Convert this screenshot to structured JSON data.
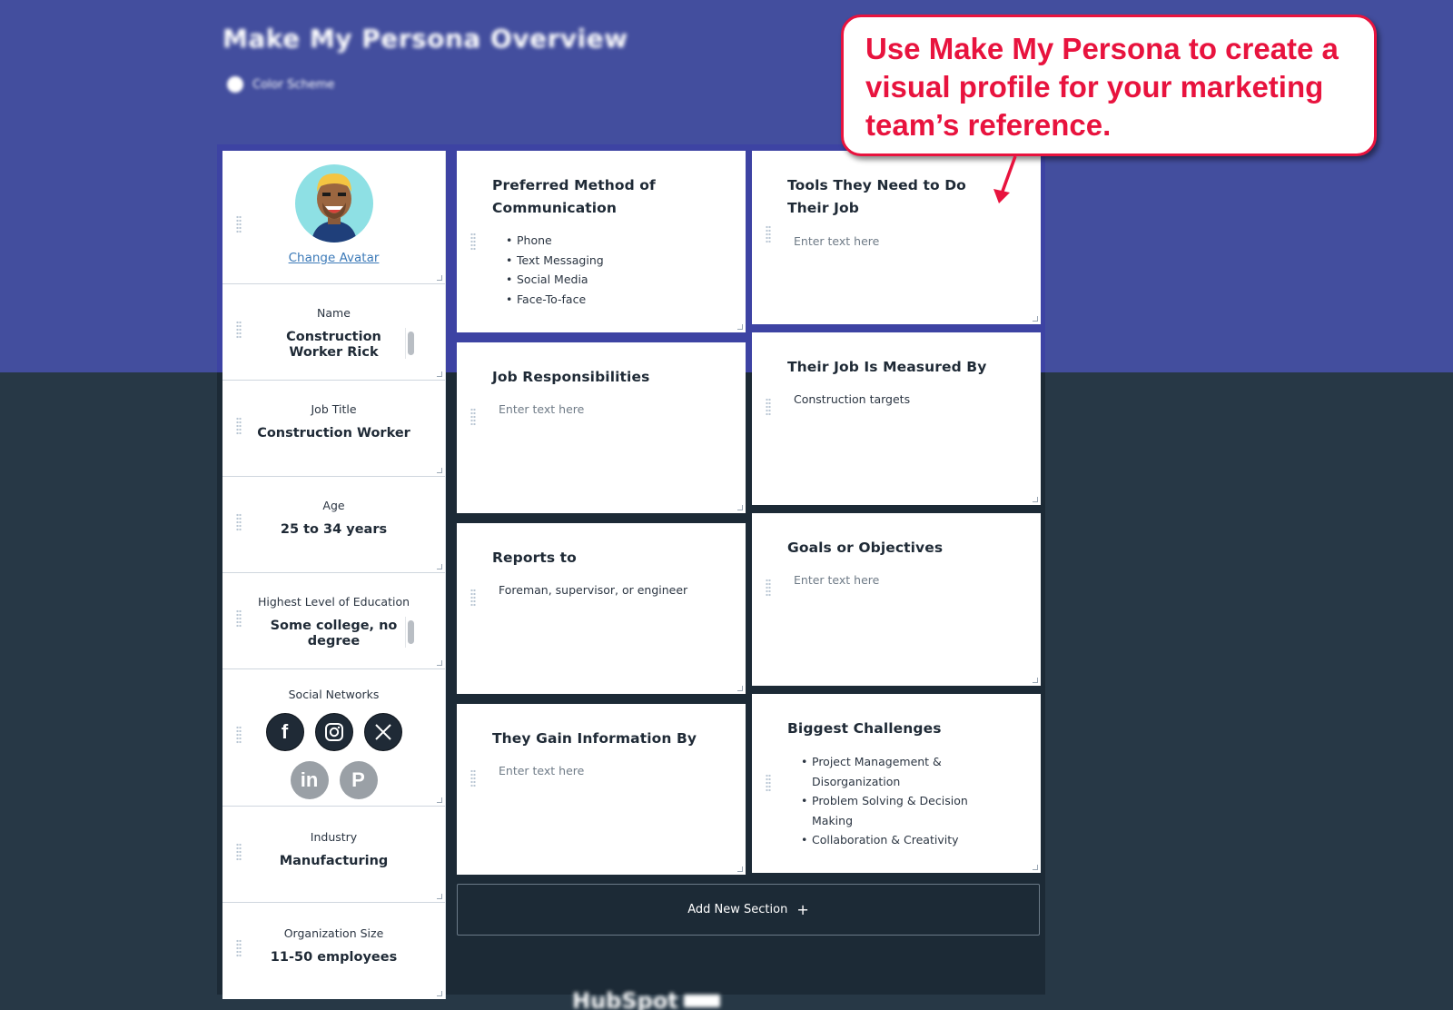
{
  "header": {
    "title": "Make My Persona Overview",
    "color_scheme_label": "Color Scheme"
  },
  "callout": {
    "text": "Use Make My Persona to create a visual profile for your marketing team’s reference.",
    "color": "#e8133e"
  },
  "profile": {
    "change_avatar_label": "Change Avatar",
    "fields": {
      "name": {
        "label": "Name",
        "value": "Construction Worker Rick"
      },
      "job_title": {
        "label": "Job Title",
        "value": "Construction Worker"
      },
      "age": {
        "label": "Age",
        "value": "25 to 34 years"
      },
      "education": {
        "label": "Highest Level of Education",
        "value": "Some college, no degree"
      },
      "social": {
        "label": "Social Networks"
      },
      "industry": {
        "label": "Industry",
        "value": "Manufacturing"
      },
      "org_size": {
        "label": "Organization Size",
        "value": "11-50 employees"
      }
    },
    "social_networks": [
      {
        "name": "facebook-icon",
        "selected": true
      },
      {
        "name": "instagram-icon",
        "selected": true
      },
      {
        "name": "x-icon",
        "selected": true
      },
      {
        "name": "linkedin-icon",
        "selected": false
      },
      {
        "name": "pinterest-icon",
        "selected": false
      }
    ]
  },
  "cards": {
    "communication": {
      "title": "Preferred Method of Communication",
      "items": [
        "Phone",
        "Text Messaging",
        "Social Media",
        "Face-To-face"
      ]
    },
    "tools": {
      "title": "Tools They Need to Do Their Job",
      "placeholder": "Enter text here"
    },
    "responsibilities": {
      "title": "Job Responsibilities",
      "placeholder": "Enter text here"
    },
    "measured": {
      "title": "Their Job Is Measured By",
      "text": "Construction targets"
    },
    "reports": {
      "title": "Reports to",
      "text": "Foreman, supervisor, or engineer"
    },
    "goals": {
      "title": "Goals or Objectives",
      "placeholder": "Enter text here"
    },
    "gain_info": {
      "title": "They Gain Information By",
      "placeholder": "Enter text here"
    },
    "challenges": {
      "title": "Biggest Challenges",
      "items": [
        "Project Management & Disorganization",
        "Problem Solving & Decision Making",
        "Collaboration & Creativity"
      ]
    }
  },
  "add_section": {
    "label": "Add New Section",
    "icon": "+"
  },
  "footer": {
    "brand": "HubSpot"
  },
  "colors": {
    "header_bg": "#434e9e",
    "page_bg": "#273846",
    "panel_bg": "#1c2a36",
    "link": "#3c7ab8"
  }
}
